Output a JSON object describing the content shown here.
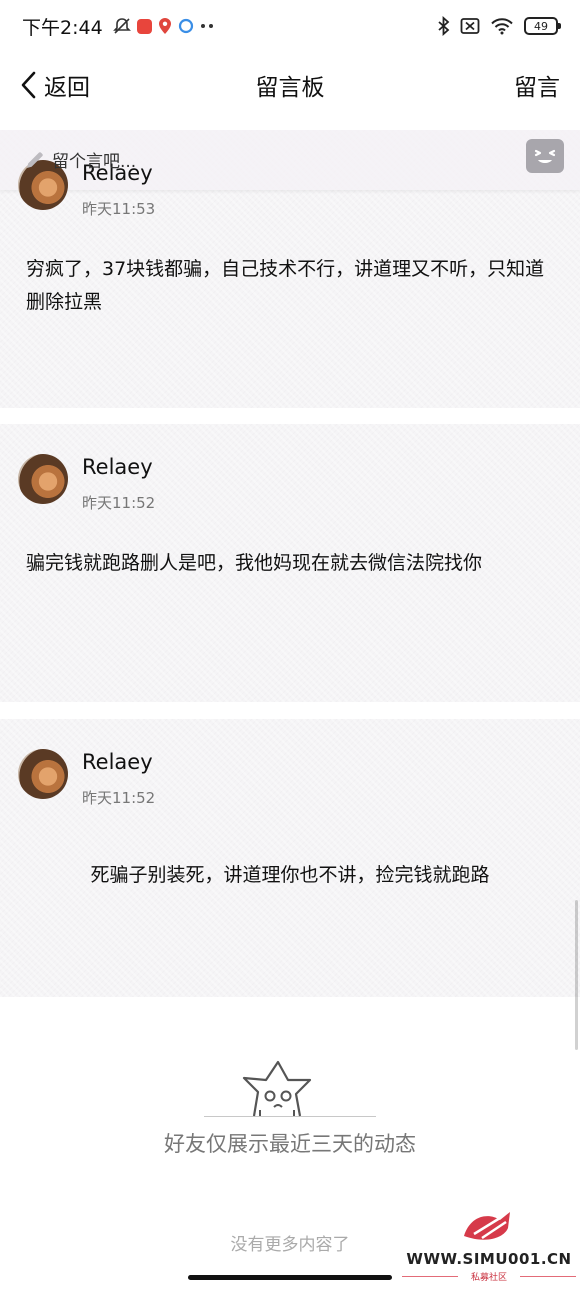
{
  "status_bar": {
    "time": "下午2:44",
    "notification_icons": [
      "mute-bell-icon",
      "red-app-icon",
      "map-pin-icon",
      "blue-app-icon",
      "more-dots-icon"
    ],
    "bluetooth": "bluetooth-icon",
    "sim": "no-sim-icon",
    "wifi": "wifi-icon",
    "battery": "49"
  },
  "nav": {
    "back_label": "返回",
    "title": "留言板",
    "action_label": "留言"
  },
  "compose": {
    "placeholder": "留个言吧..."
  },
  "messages": [
    {
      "author": "Relaey",
      "time": "昨天11:53",
      "text": "穷疯了，37块钱都骗，自己技术不行，讲道理又不听，只知道删除拉黑"
    },
    {
      "author": "Relaey",
      "time": "昨天11:52",
      "text": "骗完钱就跑路删人是吧，我他妈现在就去微信法院找你"
    },
    {
      "author": "Relaey",
      "time": "昨天11:52",
      "text": "死骗子别装死，讲道理你也不讲，捡完钱就跑路"
    }
  ],
  "footer": {
    "friends_note": "好友仅展示最近三天的动态",
    "no_more": "没有更多内容了"
  },
  "watermark": {
    "domain": "WWW.SIMU001.CN",
    "subtitle": "私募社区"
  },
  "colors": {
    "card_bg": "#f5f4f6",
    "muted_text": "#777777",
    "watermark_red": "#d63a4a"
  }
}
